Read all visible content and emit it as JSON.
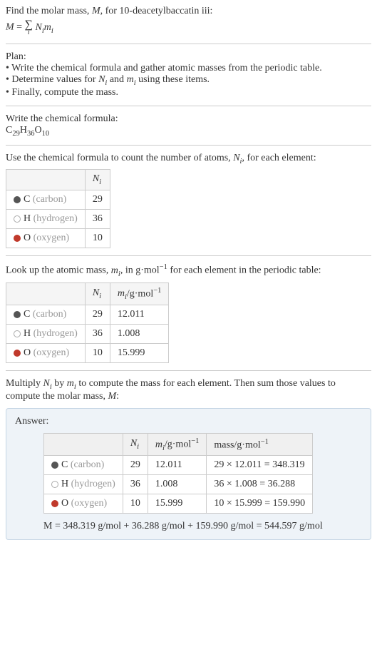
{
  "intro": {
    "line1_a": "Find the molar mass, ",
    "line1_b": ", for 10-deacetylbaccatin iii:",
    "var_M": "M",
    "Ni": "N",
    "Ni_sub": "i",
    "mi": "m",
    "mi_sub": "i",
    "sigma": "∑",
    "sigma_sub": "i"
  },
  "plan": {
    "title": "Plan:",
    "bullet1": "• Write the chemical formula and gather atomic masses from the periodic table.",
    "bullet2_a": "• Determine values for ",
    "bullet2_b": " and ",
    "bullet2_c": " using these items.",
    "bullet3": "• Finally, compute the mass."
  },
  "chemFormula": {
    "title": "Write the chemical formula:",
    "c": "C",
    "c_n": "29",
    "h": "H",
    "h_n": "36",
    "o": "O",
    "o_n": "10"
  },
  "countSection": {
    "text_a": "Use the chemical formula to count the number of atoms, ",
    "text_b": ", for each element:",
    "header_Ni": "N",
    "header_Ni_sub": "i",
    "rows": [
      {
        "dot": "dot-gray",
        "sym": "C",
        "name": "(carbon)",
        "n": "29"
      },
      {
        "dot": "dot-white",
        "sym": "H",
        "name": "(hydrogen)",
        "n": "36"
      },
      {
        "dot": "dot-red",
        "sym": "O",
        "name": "(oxygen)",
        "n": "10"
      }
    ]
  },
  "massSection": {
    "text_a": "Look up the atomic mass, ",
    "text_b": ", in g·mol",
    "text_c": " for each element in the periodic table:",
    "neg1": "−1",
    "header_mi_unit": "/g·mol",
    "rows": [
      {
        "dot": "dot-gray",
        "sym": "C",
        "name": "(carbon)",
        "n": "29",
        "m": "12.011"
      },
      {
        "dot": "dot-white",
        "sym": "H",
        "name": "(hydrogen)",
        "n": "36",
        "m": "1.008"
      },
      {
        "dot": "dot-red",
        "sym": "O",
        "name": "(oxygen)",
        "n": "10",
        "m": "15.999"
      }
    ]
  },
  "multiplySection": {
    "text_a": "Multiply ",
    "text_b": " by ",
    "text_c": " to compute the mass for each element. Then sum those values to compute the molar mass, ",
    "text_d": ":"
  },
  "answer": {
    "label": "Answer:",
    "header_mass": "mass/g·mol",
    "rows": [
      {
        "dot": "dot-gray",
        "sym": "C",
        "name": "(carbon)",
        "n": "29",
        "m": "12.011",
        "calc": "29 × 12.011 = 348.319"
      },
      {
        "dot": "dot-white",
        "sym": "H",
        "name": "(hydrogen)",
        "n": "36",
        "m": "1.008",
        "calc": "36 × 1.008 = 36.288"
      },
      {
        "dot": "dot-red",
        "sym": "O",
        "name": "(oxygen)",
        "n": "10",
        "m": "15.999",
        "calc": "10 × 15.999 = 159.990"
      }
    ],
    "final": "M = 348.319 g/mol + 36.288 g/mol + 159.990 g/mol = 544.597 g/mol"
  }
}
